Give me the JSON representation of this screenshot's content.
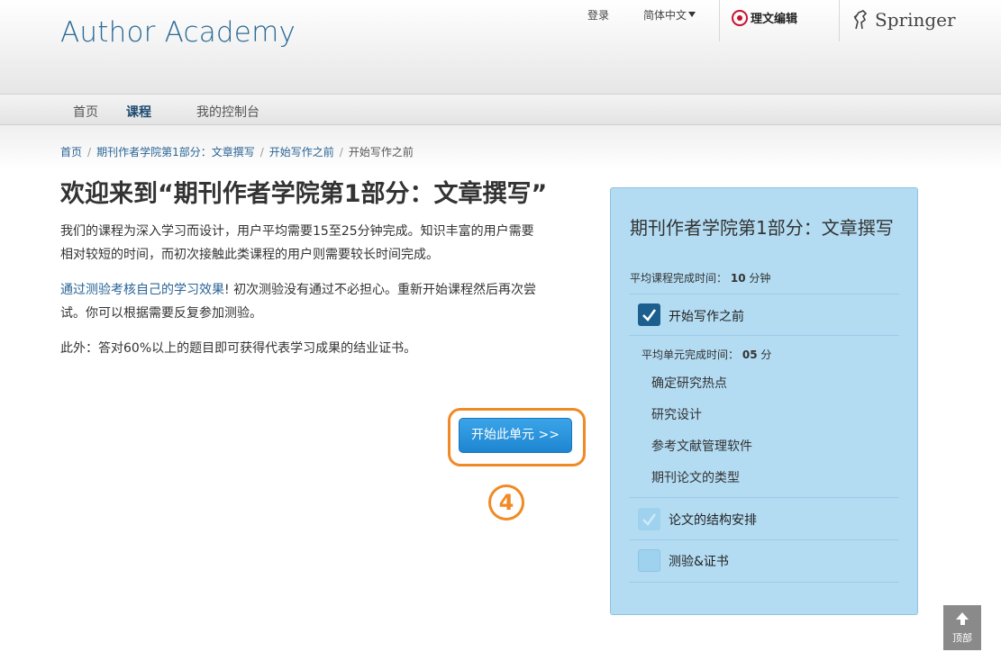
{
  "header": {
    "logo": "Author Academy",
    "login": "登录",
    "language": "简体中文",
    "partner1": "理文编辑",
    "partner2": "Springer"
  },
  "nav": {
    "home": "首页",
    "courses": "课程",
    "dashboard": "我的控制台"
  },
  "breadcrumb": {
    "home": "首页",
    "course": "期刊作者学院第1部分：文章撰写",
    "unit": "开始写作之前",
    "current": "开始写作之前"
  },
  "main": {
    "title": "欢迎来到“期刊作者学院第1部分：文章撰写”",
    "para1": "我们的课程为深入学习而设计，用户平均需要15至25分钟完成。知识丰富的用户需要相对较短的时间，而初次接触此类课程的用户则需要较长时间完成。",
    "para2_link": "通过测验考核自己的学习效果",
    "para2_rest": "! 初次测验没有通过不必担心。重新开始课程然后再次尝试。你可以根据需要反复参加测验。",
    "para3": "此外：答对60%以上的题目即可获得代表学习成果的结业证书。",
    "start_button": "开始此单元 >>",
    "step_number": "4"
  },
  "panel": {
    "title": "期刊作者学院第1部分：文章撰写",
    "avg_label": "平均课程完成时间：",
    "avg_value": "10",
    "avg_unit": "分钟",
    "units": [
      {
        "label": "开始写作之前",
        "state": "checked"
      },
      {
        "label": "论文的结构安排",
        "state": "faint-checked"
      },
      {
        "label": "测验&证书",
        "state": "unchecked"
      }
    ],
    "unit_avg_label": "平均单元完成时间：",
    "unit_avg_value": "05",
    "unit_avg_unit": "分",
    "lessons": [
      "确定研究热点",
      "研究设计",
      "参考文献管理软件",
      "期刊论文的类型"
    ]
  },
  "back_to_top": "顶部",
  "colors": {
    "accent": "#2c6a96",
    "highlight": "#f08a24",
    "panel": "#b3dcf3",
    "button": "#1e86d1"
  }
}
